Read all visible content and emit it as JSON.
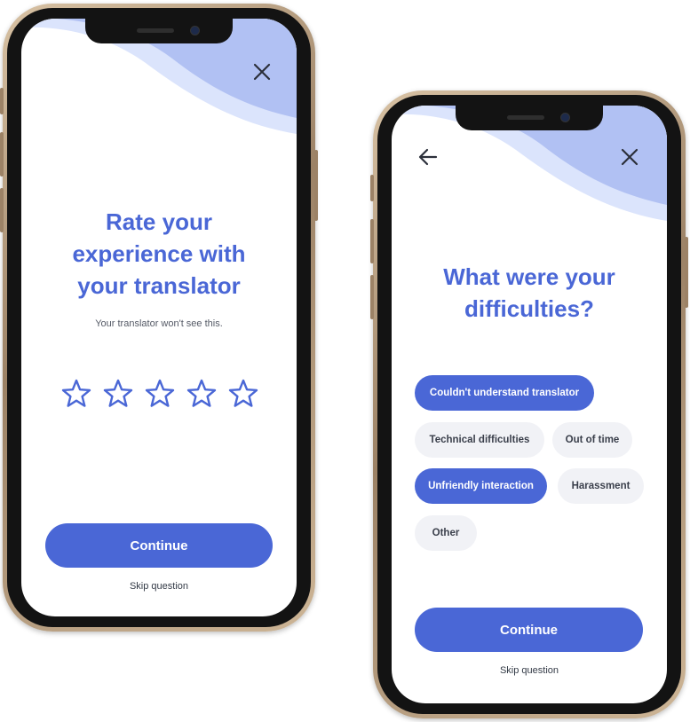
{
  "colors": {
    "accent": "#4a67d6",
    "wave_dark": "#b1c1f3",
    "wave_light": "#dbe4fc",
    "chip_unselected_bg": "#f1f2f6"
  },
  "rating_screen": {
    "close_icon": "close-icon",
    "title": "Rate your experience with your translator",
    "subtitle": "Your translator won't see this.",
    "stars": {
      "icon": "star-outline-icon",
      "max": 5,
      "value": 0
    },
    "continue_label": "Continue",
    "skip_label": "Skip question"
  },
  "difficulties_screen": {
    "back_icon": "arrow-left-icon",
    "close_icon": "close-icon",
    "title": "What were your difficulties?",
    "options": [
      {
        "label": "Couldn't understand translator",
        "selected": true
      },
      {
        "label": "Technical difficulties",
        "selected": false
      },
      {
        "label": "Out of time",
        "selected": false
      },
      {
        "label": "Unfriendly interaction",
        "selected": true
      },
      {
        "label": "Harassment",
        "selected": false
      },
      {
        "label": "Other",
        "selected": false
      }
    ],
    "continue_label": "Continue",
    "skip_label": "Skip question"
  }
}
